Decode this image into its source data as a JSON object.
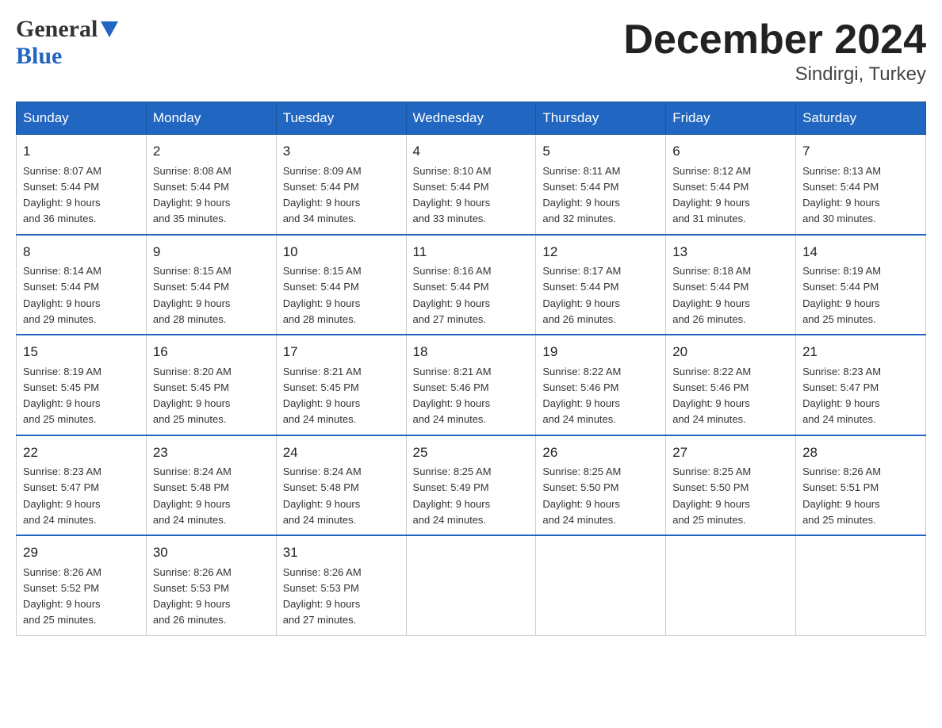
{
  "logo": {
    "general": "General",
    "blue": "Blue"
  },
  "header": {
    "month": "December 2024",
    "location": "Sindirgi, Turkey"
  },
  "weekdays": [
    "Sunday",
    "Monday",
    "Tuesday",
    "Wednesday",
    "Thursday",
    "Friday",
    "Saturday"
  ],
  "weeks": [
    [
      {
        "day": "1",
        "sunrise": "Sunrise: 8:07 AM",
        "sunset": "Sunset: 5:44 PM",
        "daylight": "Daylight: 9 hours",
        "daylight2": "and 36 minutes."
      },
      {
        "day": "2",
        "sunrise": "Sunrise: 8:08 AM",
        "sunset": "Sunset: 5:44 PM",
        "daylight": "Daylight: 9 hours",
        "daylight2": "and 35 minutes."
      },
      {
        "day": "3",
        "sunrise": "Sunrise: 8:09 AM",
        "sunset": "Sunset: 5:44 PM",
        "daylight": "Daylight: 9 hours",
        "daylight2": "and 34 minutes."
      },
      {
        "day": "4",
        "sunrise": "Sunrise: 8:10 AM",
        "sunset": "Sunset: 5:44 PM",
        "daylight": "Daylight: 9 hours",
        "daylight2": "and 33 minutes."
      },
      {
        "day": "5",
        "sunrise": "Sunrise: 8:11 AM",
        "sunset": "Sunset: 5:44 PM",
        "daylight": "Daylight: 9 hours",
        "daylight2": "and 32 minutes."
      },
      {
        "day": "6",
        "sunrise": "Sunrise: 8:12 AM",
        "sunset": "Sunset: 5:44 PM",
        "daylight": "Daylight: 9 hours",
        "daylight2": "and 31 minutes."
      },
      {
        "day": "7",
        "sunrise": "Sunrise: 8:13 AM",
        "sunset": "Sunset: 5:44 PM",
        "daylight": "Daylight: 9 hours",
        "daylight2": "and 30 minutes."
      }
    ],
    [
      {
        "day": "8",
        "sunrise": "Sunrise: 8:14 AM",
        "sunset": "Sunset: 5:44 PM",
        "daylight": "Daylight: 9 hours",
        "daylight2": "and 29 minutes."
      },
      {
        "day": "9",
        "sunrise": "Sunrise: 8:15 AM",
        "sunset": "Sunset: 5:44 PM",
        "daylight": "Daylight: 9 hours",
        "daylight2": "and 28 minutes."
      },
      {
        "day": "10",
        "sunrise": "Sunrise: 8:15 AM",
        "sunset": "Sunset: 5:44 PM",
        "daylight": "Daylight: 9 hours",
        "daylight2": "and 28 minutes."
      },
      {
        "day": "11",
        "sunrise": "Sunrise: 8:16 AM",
        "sunset": "Sunset: 5:44 PM",
        "daylight": "Daylight: 9 hours",
        "daylight2": "and 27 minutes."
      },
      {
        "day": "12",
        "sunrise": "Sunrise: 8:17 AM",
        "sunset": "Sunset: 5:44 PM",
        "daylight": "Daylight: 9 hours",
        "daylight2": "and 26 minutes."
      },
      {
        "day": "13",
        "sunrise": "Sunrise: 8:18 AM",
        "sunset": "Sunset: 5:44 PM",
        "daylight": "Daylight: 9 hours",
        "daylight2": "and 26 minutes."
      },
      {
        "day": "14",
        "sunrise": "Sunrise: 8:19 AM",
        "sunset": "Sunset: 5:44 PM",
        "daylight": "Daylight: 9 hours",
        "daylight2": "and 25 minutes."
      }
    ],
    [
      {
        "day": "15",
        "sunrise": "Sunrise: 8:19 AM",
        "sunset": "Sunset: 5:45 PM",
        "daylight": "Daylight: 9 hours",
        "daylight2": "and 25 minutes."
      },
      {
        "day": "16",
        "sunrise": "Sunrise: 8:20 AM",
        "sunset": "Sunset: 5:45 PM",
        "daylight": "Daylight: 9 hours",
        "daylight2": "and 25 minutes."
      },
      {
        "day": "17",
        "sunrise": "Sunrise: 8:21 AM",
        "sunset": "Sunset: 5:45 PM",
        "daylight": "Daylight: 9 hours",
        "daylight2": "and 24 minutes."
      },
      {
        "day": "18",
        "sunrise": "Sunrise: 8:21 AM",
        "sunset": "Sunset: 5:46 PM",
        "daylight": "Daylight: 9 hours",
        "daylight2": "and 24 minutes."
      },
      {
        "day": "19",
        "sunrise": "Sunrise: 8:22 AM",
        "sunset": "Sunset: 5:46 PM",
        "daylight": "Daylight: 9 hours",
        "daylight2": "and 24 minutes."
      },
      {
        "day": "20",
        "sunrise": "Sunrise: 8:22 AM",
        "sunset": "Sunset: 5:46 PM",
        "daylight": "Daylight: 9 hours",
        "daylight2": "and 24 minutes."
      },
      {
        "day": "21",
        "sunrise": "Sunrise: 8:23 AM",
        "sunset": "Sunset: 5:47 PM",
        "daylight": "Daylight: 9 hours",
        "daylight2": "and 24 minutes."
      }
    ],
    [
      {
        "day": "22",
        "sunrise": "Sunrise: 8:23 AM",
        "sunset": "Sunset: 5:47 PM",
        "daylight": "Daylight: 9 hours",
        "daylight2": "and 24 minutes."
      },
      {
        "day": "23",
        "sunrise": "Sunrise: 8:24 AM",
        "sunset": "Sunset: 5:48 PM",
        "daylight": "Daylight: 9 hours",
        "daylight2": "and 24 minutes."
      },
      {
        "day": "24",
        "sunrise": "Sunrise: 8:24 AM",
        "sunset": "Sunset: 5:48 PM",
        "daylight": "Daylight: 9 hours",
        "daylight2": "and 24 minutes."
      },
      {
        "day": "25",
        "sunrise": "Sunrise: 8:25 AM",
        "sunset": "Sunset: 5:49 PM",
        "daylight": "Daylight: 9 hours",
        "daylight2": "and 24 minutes."
      },
      {
        "day": "26",
        "sunrise": "Sunrise: 8:25 AM",
        "sunset": "Sunset: 5:50 PM",
        "daylight": "Daylight: 9 hours",
        "daylight2": "and 24 minutes."
      },
      {
        "day": "27",
        "sunrise": "Sunrise: 8:25 AM",
        "sunset": "Sunset: 5:50 PM",
        "daylight": "Daylight: 9 hours",
        "daylight2": "and 25 minutes."
      },
      {
        "day": "28",
        "sunrise": "Sunrise: 8:26 AM",
        "sunset": "Sunset: 5:51 PM",
        "daylight": "Daylight: 9 hours",
        "daylight2": "and 25 minutes."
      }
    ],
    [
      {
        "day": "29",
        "sunrise": "Sunrise: 8:26 AM",
        "sunset": "Sunset: 5:52 PM",
        "daylight": "Daylight: 9 hours",
        "daylight2": "and 25 minutes."
      },
      {
        "day": "30",
        "sunrise": "Sunrise: 8:26 AM",
        "sunset": "Sunset: 5:53 PM",
        "daylight": "Daylight: 9 hours",
        "daylight2": "and 26 minutes."
      },
      {
        "day": "31",
        "sunrise": "Sunrise: 8:26 AM",
        "sunset": "Sunset: 5:53 PM",
        "daylight": "Daylight: 9 hours",
        "daylight2": "and 27 minutes."
      },
      null,
      null,
      null,
      null
    ]
  ]
}
